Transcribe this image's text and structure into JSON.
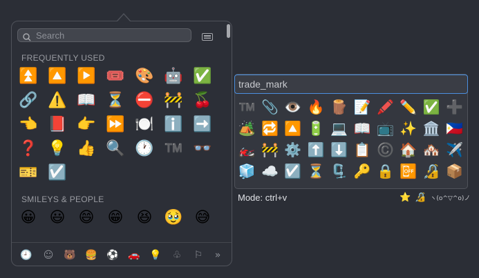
{
  "picker": {
    "search": {
      "placeholder": "Search",
      "value": ""
    },
    "sections": {
      "frequent": "FREQUENTLY USED",
      "smileys": "SMILEYS & PEOPLE"
    },
    "frequent_emojis": [
      [
        "⏫",
        "🔼",
        "▶️",
        "🎟️",
        "🎨",
        "🤖",
        "✅"
      ],
      [
        "🔗",
        "⚠️",
        "📖",
        "⏳",
        "⛔",
        "🚧",
        "🍒"
      ],
      [
        "👈",
        "📕",
        "👉",
        "⏩",
        "🍽️",
        "ℹ️",
        "➡️"
      ],
      [
        "❓",
        "💡",
        "👍",
        "🔍",
        "🕐",
        "™️",
        "👓"
      ],
      [
        "🎫",
        "☑️"
      ]
    ],
    "smiley_emojis": [
      "😀",
      "😃",
      "😄",
      "😁",
      "😆",
      "🥹",
      "😅"
    ],
    "tabs": [
      {
        "icon": "clock-icon",
        "glyph": "🕘"
      },
      {
        "icon": "smiley-icon",
        "glyph": "☺"
      },
      {
        "icon": "bear-icon",
        "glyph": "🐻"
      },
      {
        "icon": "food-icon",
        "glyph": "🍔"
      },
      {
        "icon": "ball-icon",
        "glyph": "⚽"
      },
      {
        "icon": "car-icon",
        "glyph": "🚗"
      },
      {
        "icon": "bulb-icon",
        "glyph": "💡"
      },
      {
        "icon": "symbols-icon",
        "glyph": "♧"
      },
      {
        "icon": "flag-icon",
        "glyph": "⚐"
      },
      {
        "icon": "more-icon",
        "glyph": "»"
      }
    ]
  },
  "search_panel": {
    "query": "trade_mark",
    "results": [
      [
        "™️",
        "📎",
        "👁️",
        "🔥",
        "🪵",
        "📝",
        "🖍️",
        "✏️",
        "✅",
        "➕"
      ],
      [
        "🏕️",
        "🔁",
        "🔼",
        "🔋",
        "💻",
        "📖",
        "📺",
        "✨",
        "🏛️",
        "🇵🇭"
      ],
      [
        "🏍️",
        "🚧",
        "⚙️",
        "⬆️",
        "⬇️",
        "📋",
        "©️",
        "🏠",
        "🏘️",
        "✈️"
      ],
      [
        "🧊",
        "☁️",
        "☑️",
        "⏳",
        "🗜️",
        "🔑",
        "🔒",
        "📴",
        "🔏",
        "📦"
      ]
    ]
  },
  "status": {
    "mode": "Mode: ctrl+v",
    "star": "⭐",
    "lock": "🔏",
    "kaomoji": "ヽ(o^▽^o)ノ"
  }
}
